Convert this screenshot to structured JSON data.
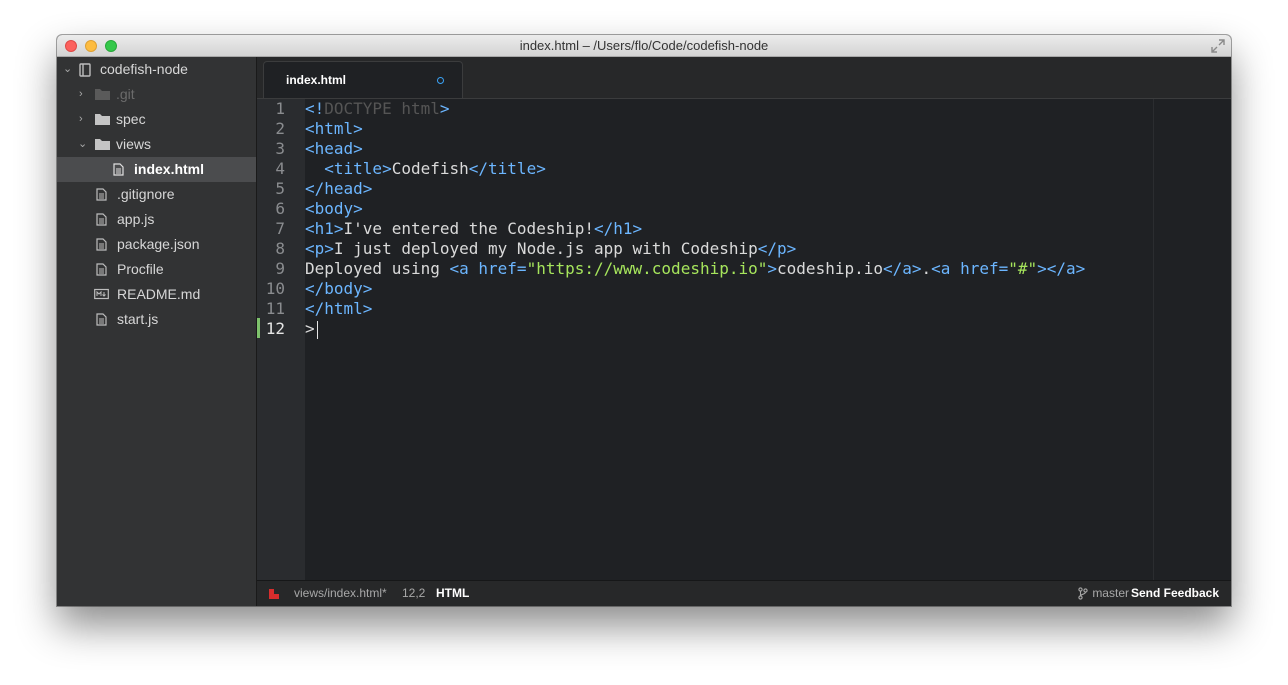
{
  "window": {
    "title": "index.html – /Users/flo/Code/codefish-node"
  },
  "sidebar": {
    "project": "codefish-node",
    "items": [
      {
        "label": ".git"
      },
      {
        "label": "spec"
      },
      {
        "label": "views"
      },
      {
        "label": "index.html"
      },
      {
        "label": ".gitignore"
      },
      {
        "label": "app.js"
      },
      {
        "label": "package.json"
      },
      {
        "label": "Procfile"
      },
      {
        "label": "README.md"
      },
      {
        "label": "start.js"
      }
    ]
  },
  "tabs": [
    {
      "label": "index.html",
      "modified": true
    }
  ],
  "editor": {
    "line_numbers": [
      "1",
      "2",
      "3",
      "4",
      "5",
      "6",
      "7",
      "8",
      "9",
      "10",
      "11",
      "12"
    ],
    "current_line": "12",
    "lines": [
      {
        "t1": "<!",
        "t2": "DOCTYPE html",
        "t3": ">"
      },
      {
        "t1": "<html>"
      },
      {
        "t1": "<head>"
      },
      {
        "t1": "  <title>",
        "t2": "Codefish",
        "t3": "</title>"
      },
      {
        "t1": "</head>"
      },
      {
        "t1": "<body>"
      },
      {
        "t1": "<h1>",
        "t2": "I've entered the Codeship!",
        "t3": "</h1>"
      },
      {
        "t1": "<p>",
        "t2": "I just deployed my Node.js app with Codeship",
        "t3": "</p>"
      },
      {
        "t1": "Deployed using ",
        "t2": "<a href=",
        "t3": "\"https://www.codeship.io\"",
        "t4": ">",
        "t5": "codeship.io",
        "t6": "</a>",
        "t7": ".",
        "t8": "<a href=",
        "t9": "\"#\"",
        "t10": "></a>"
      },
      {
        "t1": "</body>"
      },
      {
        "t1": "</html>"
      },
      {
        "t1": ">"
      }
    ]
  },
  "statusbar": {
    "file": "views/index.html*",
    "position": "12,2",
    "grammar": "HTML",
    "branch": "master",
    "feedback": "Send Feedback"
  },
  "colors": {
    "tag": "#6cb6ff",
    "string": "#a6e55c",
    "gutter_marker": "#7ec26c",
    "tab_modified": "#3aa2f5"
  },
  "icons": {
    "close": "close-icon",
    "minimize": "minimize-icon",
    "zoom": "zoom-icon",
    "fullscreen": "fullscreen-icon",
    "repo": "repo-icon",
    "folder": "folder-icon",
    "file": "file-icon",
    "markdown": "markdown-icon",
    "branch": "branch-icon",
    "status": "status-icon"
  }
}
